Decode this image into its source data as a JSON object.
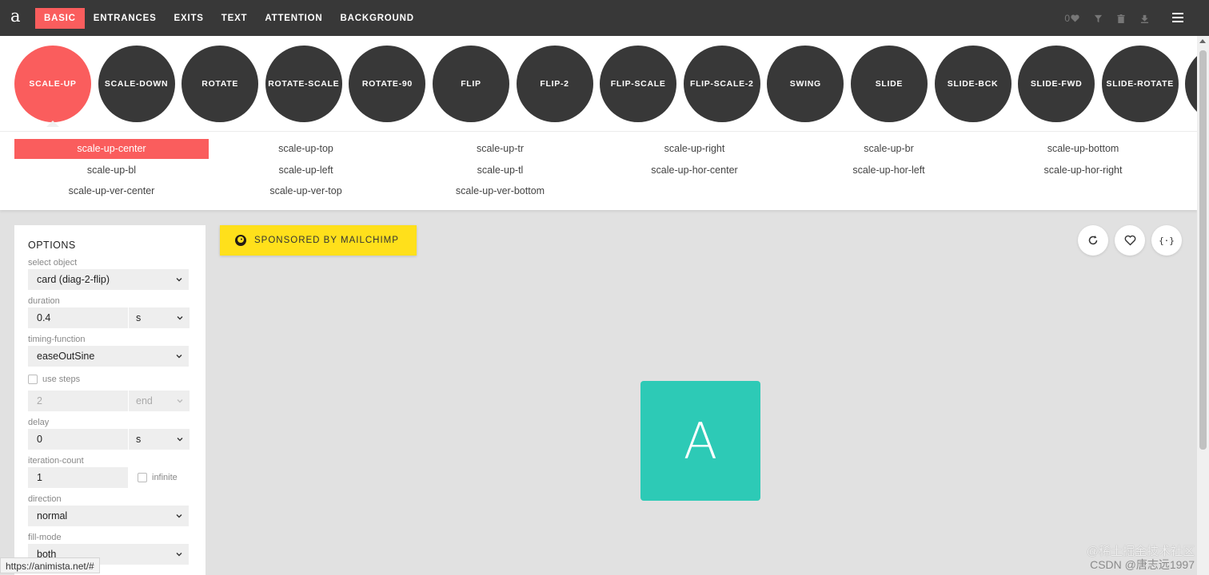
{
  "app": {
    "logo": "a"
  },
  "nav": {
    "items": [
      {
        "label": "BASIC",
        "active": true
      },
      {
        "label": "ENTRANCES",
        "active": false
      },
      {
        "label": "EXITS",
        "active": false
      },
      {
        "label": "TEXT",
        "active": false
      },
      {
        "label": "ATTENTION",
        "active": false
      },
      {
        "label": "BACKGROUND",
        "active": false
      }
    ],
    "favorites_count": "0",
    "icons": [
      "heart-icon",
      "filter-icon",
      "trash-icon",
      "download-icon",
      "hamburger-menu-icon"
    ]
  },
  "animations": [
    {
      "label": "SCALE-UP",
      "active": true
    },
    {
      "label": "SCALE-DOWN",
      "active": false
    },
    {
      "label": "ROTATE",
      "active": false
    },
    {
      "label": "ROTATE-SCALE",
      "active": false
    },
    {
      "label": "ROTATE-90",
      "active": false
    },
    {
      "label": "FLIP",
      "active": false
    },
    {
      "label": "FLIP-2",
      "active": false
    },
    {
      "label": "FLIP-SCALE",
      "active": false
    },
    {
      "label": "FLIP-SCALE-2",
      "active": false
    },
    {
      "label": "SWING",
      "active": false
    },
    {
      "label": "SLIDE",
      "active": false
    },
    {
      "label": "SLIDE-BCK",
      "active": false
    },
    {
      "label": "SLIDE-FWD",
      "active": false
    },
    {
      "label": "SLIDE-ROTATE",
      "active": false
    },
    {
      "label": "",
      "active": false
    }
  ],
  "variants": [
    [
      "scale-up-center",
      "scale-up-top",
      "scale-up-tr",
      "scale-up-right",
      "scale-up-br",
      "scale-up-bottom"
    ],
    [
      "scale-up-bl",
      "scale-up-left",
      "scale-up-tl",
      "scale-up-hor-center",
      "scale-up-hor-left",
      "scale-up-hor-right"
    ],
    [
      "scale-up-ver-center",
      "scale-up-ver-top",
      "scale-up-ver-bottom"
    ]
  ],
  "options": {
    "title": "OPTIONS",
    "select_object": {
      "label": "select object",
      "value": "card (diag-2-flip)"
    },
    "duration": {
      "label": "duration",
      "value": "0.4",
      "unit": "s"
    },
    "timing_function": {
      "label": "timing-function",
      "value": "easeOutSine"
    },
    "use_steps": {
      "label": "use steps",
      "checked": false,
      "value": "2",
      "mode": "end"
    },
    "delay": {
      "label": "delay",
      "value": "0",
      "unit": "s"
    },
    "iteration_count": {
      "label": "iteration-count",
      "value": "1",
      "infinite_label": "infinite"
    },
    "direction": {
      "label": "direction",
      "value": "normal"
    },
    "fill_mode": {
      "label": "fill-mode",
      "value": "both"
    }
  },
  "stage": {
    "sponsor": "SPONSORED BY MAILCHIMP",
    "card_letter": "A",
    "card_color": "#2dcab6",
    "actions": [
      "replay-icon",
      "heart-icon",
      "code-icon"
    ]
  },
  "status_url": "https://animista.net/#",
  "watermark": {
    "line1": "@稀土掘金技术社区",
    "line2": "CSDN @唐志远1997"
  },
  "colors": {
    "accent": "#fa5d5d",
    "dark": "#383838",
    "sponsor": "#ffe01b"
  }
}
